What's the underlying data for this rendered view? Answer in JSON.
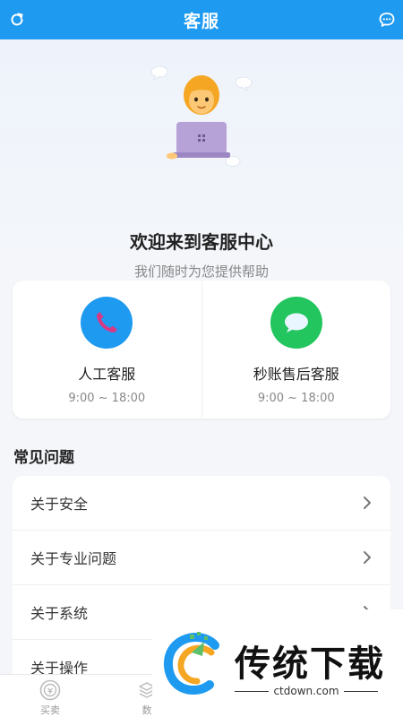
{
  "header": {
    "title": "客服",
    "refresh_icon": "refresh-icon",
    "message_icon": "chat-bubble-icon",
    "color": "#1e9af0"
  },
  "hero": {
    "title": "欢迎来到客服中心",
    "subtitle": "我们随时为您提供帮助"
  },
  "services": [
    {
      "name": "人工客服",
      "hours": "9:00 ~ 18:00",
      "icon": "phone-icon",
      "color": "#1e9af0"
    },
    {
      "name": "秒账售后客服",
      "hours": "9:00 ~ 18:00",
      "icon": "speech-bubble-icon",
      "color": "#22c55e"
    }
  ],
  "faq": {
    "heading": "常见问题",
    "items": [
      {
        "label": "关于安全"
      },
      {
        "label": "关于专业问题"
      },
      {
        "label": "关于系统"
      },
      {
        "label": "关于操作"
      }
    ]
  },
  "tabbar": {
    "tabs": [
      {
        "label": "买卖",
        "icon": "buy-sell-icon"
      },
      {
        "label": "数",
        "icon": "data-icon"
      }
    ]
  },
  "watermark": {
    "text": "传统下载",
    "url": "ctdown.com"
  }
}
